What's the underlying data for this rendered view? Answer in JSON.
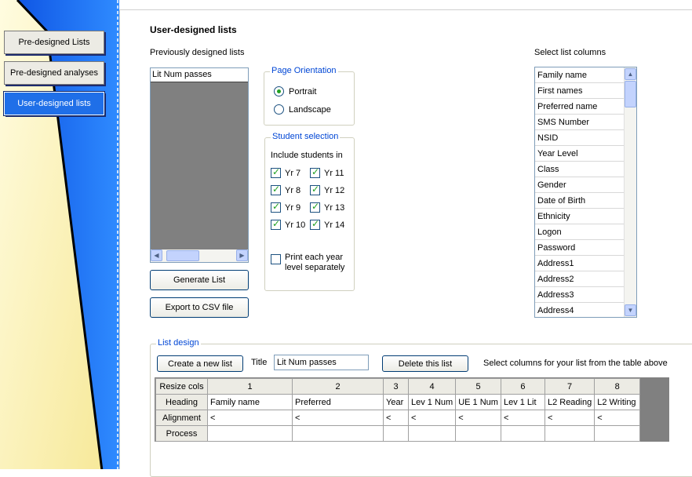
{
  "nav": {
    "items": [
      {
        "label": "Pre-designed Lists"
      },
      {
        "label": "Pre-designed analyses"
      },
      {
        "label": "User-designed lists"
      }
    ]
  },
  "main": {
    "title": "User-designed lists",
    "previous_label": "Previously designed lists",
    "previous_items": [
      "Lit Num passes"
    ],
    "generate_button": "Generate List",
    "export_button": "Export to CSV file",
    "orientation": {
      "legend": "Page Orientation",
      "options": [
        {
          "label": "Portrait",
          "selected": true
        },
        {
          "label": "Landscape",
          "selected": false
        }
      ]
    },
    "student_selection": {
      "legend": "Student selection",
      "include_label": "Include students in",
      "years": [
        {
          "label": "Yr 7",
          "checked": true
        },
        {
          "label": "Yr 11",
          "checked": true
        },
        {
          "label": "Yr 8",
          "checked": true
        },
        {
          "label": "Yr 12",
          "checked": true
        },
        {
          "label": "Yr 9",
          "checked": true
        },
        {
          "label": "Yr 13",
          "checked": true
        },
        {
          "label": "Yr 10",
          "checked": true
        },
        {
          "label": "Yr 14",
          "checked": true
        }
      ],
      "print_separately": {
        "label_line1": "Print each year",
        "label_line2": "level separately",
        "checked": false
      }
    },
    "columns_label": "Select list columns",
    "columns": [
      "Family name",
      "First names",
      "Preferred name",
      "SMS Number",
      "NSID",
      "Year Level",
      "Class",
      "Gender",
      "Date of Birth",
      "Ethnicity",
      "Logon",
      "Password",
      "Address1",
      "Address2",
      "Address3",
      "Address4"
    ]
  },
  "design": {
    "legend": "List design",
    "new_button": "Create a new list",
    "title_label": "Title",
    "title_value": "Lit Num passes",
    "delete_button": "Delete this list",
    "hint": "Select columns for your list from the table above",
    "grid": {
      "row_labels": [
        "Resize cols",
        "Heading",
        "Alignment",
        "Process"
      ],
      "col_numbers": [
        "1",
        "2",
        "3",
        "4",
        "5",
        "6",
        "7",
        "8"
      ],
      "headings": [
        "Family name",
        "Preferred",
        "Year",
        "Lev 1 Num",
        "UE 1 Num",
        "Lev 1 Lit",
        "L2 Reading",
        "L2 Writing"
      ],
      "alignments": [
        "<",
        "<",
        "<",
        "<",
        "<",
        "<",
        "<",
        "<"
      ],
      "process": [
        "",
        "",
        "",
        "",
        "",
        "",
        "",
        ""
      ]
    }
  },
  "colors": {
    "nav_blue": "#0a5cf5",
    "nav_yellow": "#fdf3b0",
    "active_button": "#1f6fe8",
    "legend_text": "#0046d5",
    "check_green": "#21a121"
  }
}
